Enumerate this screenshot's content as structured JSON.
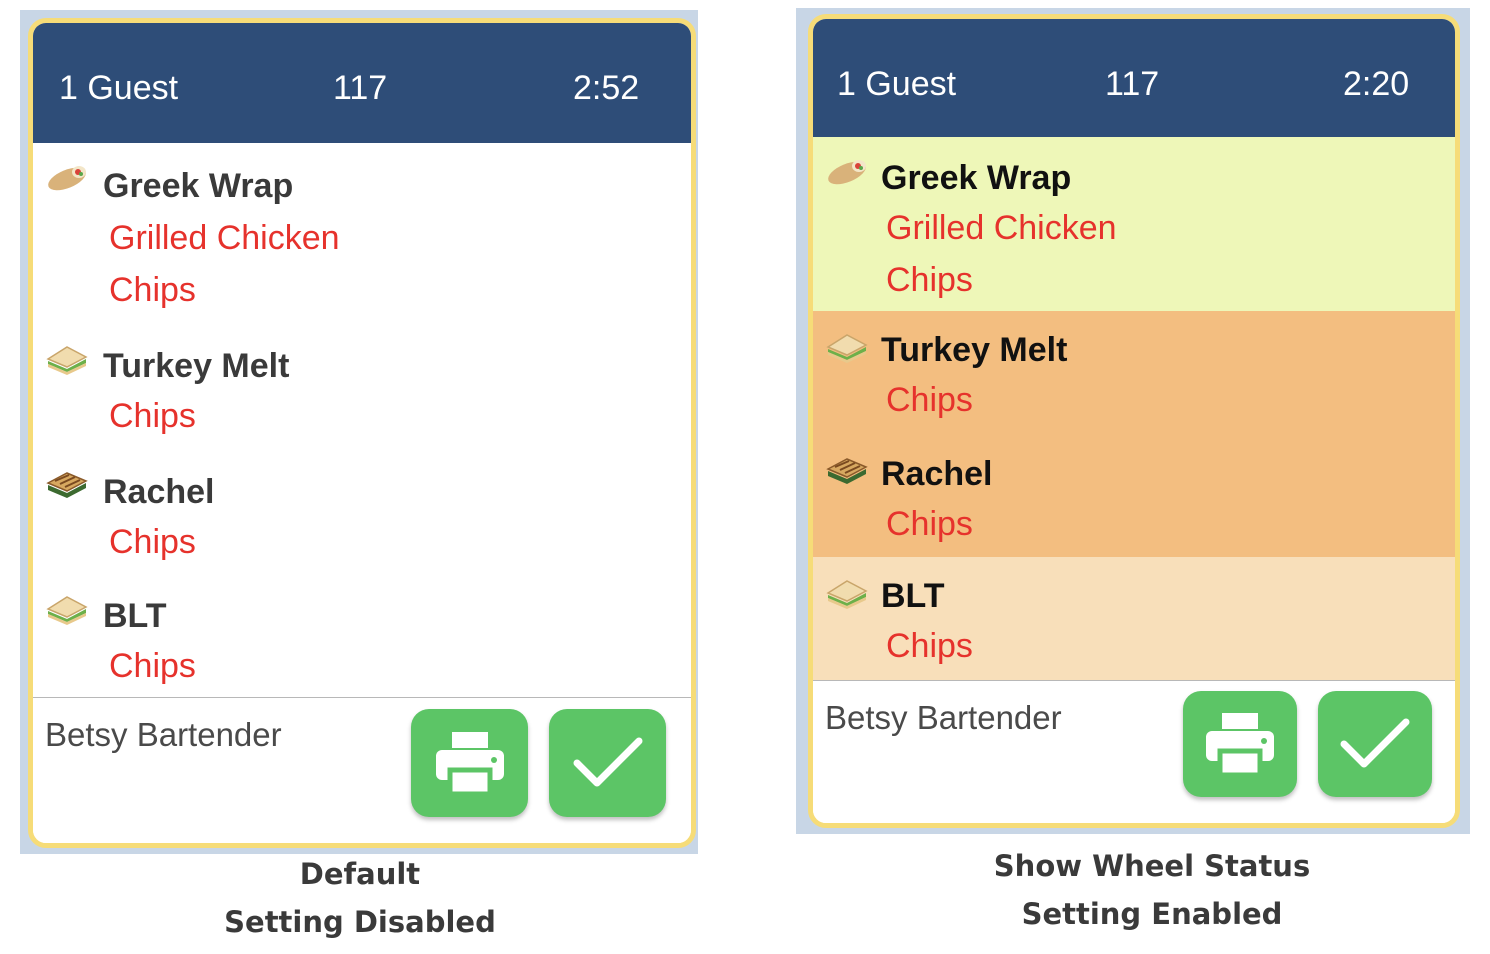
{
  "panels": [
    {
      "header": {
        "guests": "1 Guest",
        "table": "117",
        "time": "2:52"
      },
      "items": [
        {
          "name": "Greek Wrap",
          "icon": "wrap-icon",
          "mods": [
            "Grilled Chicken",
            "Chips"
          ],
          "bg": "#ffffff"
        },
        {
          "name": "Turkey Melt",
          "icon": "sandwich-icon",
          "mods": [
            "Chips"
          ],
          "bg": "#ffffff"
        },
        {
          "name": "Rachel",
          "icon": "panini-icon",
          "mods": [
            "Chips"
          ],
          "bg": "#ffffff"
        },
        {
          "name": "BLT",
          "icon": "sandwich-icon",
          "mods": [
            "Chips"
          ],
          "bg": "#ffffff"
        }
      ],
      "footer": {
        "server": "Betsy Bartender",
        "print_icon": "printer-icon",
        "done_icon": "checkmark-icon"
      },
      "caption": [
        "Default",
        "Setting Disabled"
      ]
    },
    {
      "header": {
        "guests": "1 Guest",
        "table": "117",
        "time": "2:20"
      },
      "items": [
        {
          "name": "Greek Wrap",
          "icon": "wrap-icon",
          "mods": [
            "Grilled Chicken",
            "Chips"
          ],
          "bg": "#eef7b8"
        },
        {
          "name": "Turkey Melt",
          "icon": "sandwich-icon",
          "mods": [
            "Chips"
          ],
          "bg": "#f3be80"
        },
        {
          "name": "Rachel",
          "icon": "panini-icon",
          "mods": [
            "Chips"
          ],
          "bg": "#f3be80"
        },
        {
          "name": "BLT",
          "icon": "sandwich-icon",
          "mods": [
            "Chips"
          ],
          "bg": "#f8dfba"
        }
      ],
      "footer": {
        "server": "Betsy Bartender",
        "print_icon": "printer-icon",
        "done_icon": "checkmark-icon"
      },
      "caption": [
        "Show Wheel Status",
        "Setting Enabled"
      ]
    }
  ],
  "colors": {
    "header": "#2e4d78",
    "border": "#f6dc78",
    "modifier": "#e6322c",
    "button": "#5cc566"
  }
}
